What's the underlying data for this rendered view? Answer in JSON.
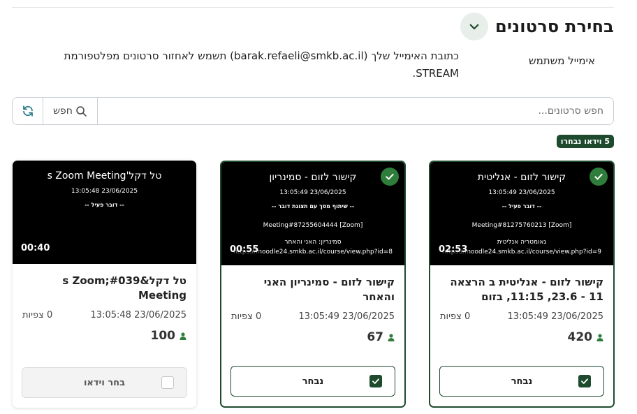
{
  "header": {
    "title": "בחירת סרטונים"
  },
  "user": {
    "email_label": "אימייל משתמש",
    "email_info": "כתובת האימייל שלך (barak.refaeli@smkb.ac.il) תשמש לאחזור סרטונים מפלטפורמת STREAM."
  },
  "search": {
    "placeholder": "חפש סרטונים...",
    "button_label": "חפש"
  },
  "selected_badge": "5 וידאו נבחרו",
  "cards": [
    {
      "thumb_title": "קישור לזום - אנליטית",
      "thumb_date": "23/06/2025 13:05:49",
      "thumb_status": "-- דובר פעיל --",
      "thumb_meeting": "[Zoom] Meeting#81275760213",
      "thumb_course": "גאומטריה אנליטית",
      "thumb_url": "https://moodle24.smkb.ac.il/course/view.php?id=9",
      "duration": "02:53",
      "title": "קישור לזום - אנליטית ב הרצאה 11 - 23.6, 11:15, בזום",
      "datetime": "23/06/2025 13:05:49",
      "views": "0 צפיות",
      "participants": "420",
      "button_label": "נבחר",
      "selected": true
    },
    {
      "thumb_title": "קישור לזום - סמינריון",
      "thumb_date": "23/06/2025 13:05:49",
      "thumb_status": "-- שיתוף מסך עם תצוגת דובר --",
      "thumb_meeting": "[Zoom] Meeting#87255604444",
      "thumb_course": "סמינריון: האני והאחר",
      "thumb_url": "https://moodle24.smkb.ac.il/course/view.php?id=8",
      "duration": "00:55",
      "title": "קישור לזום - סמינריון האני והאחר",
      "datetime": "23/06/2025 13:05:49",
      "views": "0 צפיות",
      "participants": "67",
      "button_label": "נבחר",
      "selected": true
    },
    {
      "thumb_title": "טל דקל's Zoom Meeting",
      "thumb_date": "23/06/2025 13:05:48",
      "thumb_status": "-- דובר פעיל --",
      "thumb_meeting": "",
      "thumb_course": "",
      "thumb_url": "",
      "duration": "00:40",
      "title": "טל דקל&#039;s Zoom Meeting",
      "datetime": "23/06/2025 13:05:48",
      "views": "0 צפיות",
      "participants": "100",
      "button_label": "בחר וידאו",
      "selected": false
    }
  ],
  "colors": {
    "accent": "#1e4b2e",
    "check_green": "#2f7d3b"
  }
}
